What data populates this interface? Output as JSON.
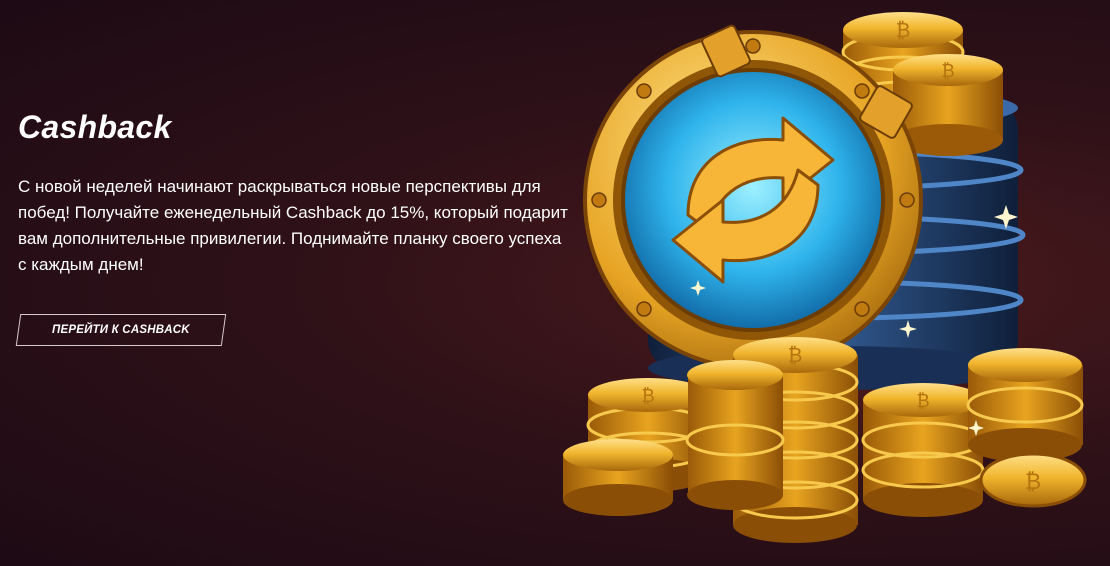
{
  "promo": {
    "title": "Cashback",
    "description": "С новой неделей начинают раскрываться новые перспективы для побед! Получайте еженедельный Cashback до 15%, который подарит вам дополнительные привилегии. Поднимайте планку своего успеха с каждым днем!",
    "cta_label": "ПЕРЕЙТИ К CASHBACK"
  },
  "colors": {
    "background": "#2a0f17",
    "text": "#ffffff",
    "button_border": "#d9c8cc",
    "gold": "#f1b52d",
    "gold_dark": "#b5740f",
    "portal_blue": "#3fc6f4",
    "drum_blue": "#2a4a78"
  },
  "icons": {
    "illustration": "coin-stack-cashback-illustration",
    "refresh": "refresh-arrows-icon"
  }
}
